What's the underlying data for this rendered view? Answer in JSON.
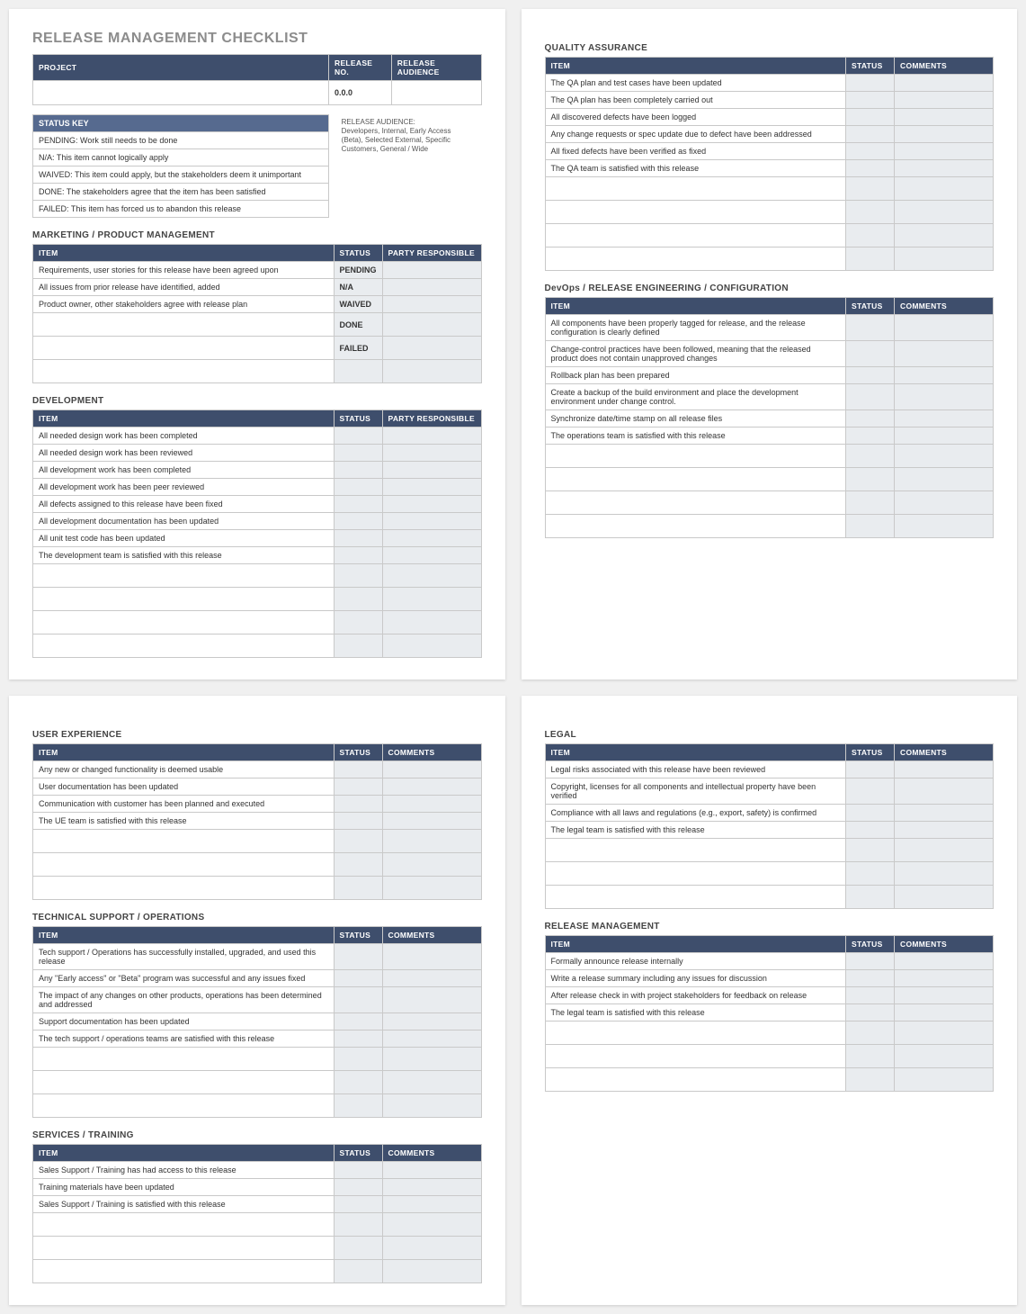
{
  "title": "RELEASE MANAGEMENT CHECKLIST",
  "project_table": {
    "headers": {
      "project": "PROJECT",
      "release_no": "RELEASE NO.",
      "release_audience": "RELEASE AUDIENCE"
    },
    "values": {
      "project": "",
      "release_no": "0.0.0",
      "release_audience": ""
    }
  },
  "release_audience_note": {
    "label": "RELEASE AUDIENCE:",
    "text": "Developers, Internal, Early Access (Beta), Selected External, Specific Customers, General / Wide"
  },
  "status_key": {
    "header": "STATUS KEY",
    "rows": [
      "PENDING:  Work still needs to be done",
      "N/A:  This item cannot logically apply",
      "WAIVED:  This item could apply, but the stakeholders deem it unimportant",
      "DONE:  The stakeholders agree that the item has been satisfied",
      "FAILED:  This item has forced us to abandon this release"
    ]
  },
  "headers": {
    "item": "ITEM",
    "status": "STATUS",
    "party": "PARTY RESPONSIBLE",
    "comments": "COMMENTS"
  },
  "sections": {
    "marketing": {
      "title": "MARKETING / PRODUCT MANAGEMENT",
      "third": "party",
      "rows": [
        {
          "item": "Requirements, user stories for this release have been agreed upon",
          "status": "PENDING"
        },
        {
          "item": "All issues from prior release have identified, added",
          "status": "N/A"
        },
        {
          "item": "Product owner, other stakeholders agree with release plan",
          "status": "WAIVED"
        },
        {
          "item": "",
          "status": "DONE"
        },
        {
          "item": "",
          "status": "FAILED"
        },
        {
          "item": "",
          "status": ""
        }
      ]
    },
    "development": {
      "title": "DEVELOPMENT",
      "third": "party",
      "rows": [
        {
          "item": "All needed design work has been completed",
          "status": ""
        },
        {
          "item": "All needed design work has been reviewed",
          "status": ""
        },
        {
          "item": "All development work has been completed",
          "status": ""
        },
        {
          "item": "All development work has been peer reviewed",
          "status": ""
        },
        {
          "item": "All defects assigned to this release have been fixed",
          "status": ""
        },
        {
          "item": "All development documentation has been updated",
          "status": ""
        },
        {
          "item": "All unit test code has been updated",
          "status": ""
        },
        {
          "item": "The development team is satisfied with this release",
          "status": ""
        },
        {
          "item": "",
          "status": ""
        },
        {
          "item": "",
          "status": ""
        },
        {
          "item": "",
          "status": ""
        },
        {
          "item": "",
          "status": ""
        }
      ]
    },
    "qa": {
      "title": "QUALITY ASSURANCE",
      "third": "comments",
      "rows": [
        {
          "item": "The QA plan and test cases have been updated",
          "status": ""
        },
        {
          "item": "The QA plan has been completely carried out",
          "status": ""
        },
        {
          "item": "All discovered defects have been logged",
          "status": ""
        },
        {
          "item": "Any change requests or spec update due to defect have been addressed",
          "status": ""
        },
        {
          "item": "All fixed defects have been verified as fixed",
          "status": ""
        },
        {
          "item": "The QA team is satisfied with this release",
          "status": ""
        },
        {
          "item": "",
          "status": ""
        },
        {
          "item": "",
          "status": ""
        },
        {
          "item": "",
          "status": ""
        },
        {
          "item": "",
          "status": ""
        }
      ]
    },
    "devops": {
      "title": "DevOps / RELEASE ENGINEERING / CONFIGURATION",
      "third": "comments",
      "rows": [
        {
          "item": "All components have been properly tagged for release, and the release configuration is clearly defined",
          "status": ""
        },
        {
          "item": "Change-control practices have been followed, meaning that the released product does not contain unapproved changes",
          "status": ""
        },
        {
          "item": "Rollback plan has been prepared",
          "status": ""
        },
        {
          "item": "Create a backup of the build environment and place the development environment under change control.",
          "status": ""
        },
        {
          "item": "Synchronize date/time stamp on all release files",
          "status": ""
        },
        {
          "item": "The operations team is satisfied with this release",
          "status": ""
        },
        {
          "item": "",
          "status": ""
        },
        {
          "item": "",
          "status": ""
        },
        {
          "item": "",
          "status": ""
        },
        {
          "item": "",
          "status": ""
        }
      ]
    },
    "ux": {
      "title": "USER EXPERIENCE",
      "third": "comments",
      "rows": [
        {
          "item": "Any new or changed functionality is deemed usable",
          "status": ""
        },
        {
          "item": "User documentation has been updated",
          "status": ""
        },
        {
          "item": "Communication with customer has been planned and executed",
          "status": ""
        },
        {
          "item": "The UE team is satisfied with this release",
          "status": ""
        },
        {
          "item": "",
          "status": ""
        },
        {
          "item": "",
          "status": ""
        },
        {
          "item": "",
          "status": ""
        }
      ]
    },
    "tech": {
      "title": "TECHNICAL SUPPORT / OPERATIONS",
      "third": "comments",
      "rows": [
        {
          "item": "Tech support / Operations has successfully installed, upgraded, and used this release",
          "status": ""
        },
        {
          "item": "Any \"Early access\" or \"Beta\" program was successful and any issues fixed",
          "status": ""
        },
        {
          "item": "The impact of any changes on other products, operations has been determined and addressed",
          "status": ""
        },
        {
          "item": "Support documentation has been updated",
          "status": ""
        },
        {
          "item": "The tech support / operations teams are satisfied with this release",
          "status": ""
        },
        {
          "item": "",
          "status": ""
        },
        {
          "item": "",
          "status": ""
        },
        {
          "item": "",
          "status": ""
        }
      ]
    },
    "services": {
      "title": "SERVICES / TRAINING",
      "third": "comments",
      "rows": [
        {
          "item": "Sales Support / Training has had access to this release",
          "status": ""
        },
        {
          "item": "Training materials have been updated",
          "status": ""
        },
        {
          "item": "Sales Support / Training is satisfied with this release",
          "status": ""
        },
        {
          "item": "",
          "status": ""
        },
        {
          "item": "",
          "status": ""
        },
        {
          "item": "",
          "status": ""
        }
      ]
    },
    "legal": {
      "title": "LEGAL",
      "third": "comments",
      "rows": [
        {
          "item": "Legal risks associated with this release have been reviewed",
          "status": ""
        },
        {
          "item": "Copyright, licenses for all components and intellectual property have been verified",
          "status": ""
        },
        {
          "item": "Compliance with all laws and regulations (e.g., export, safety) is confirmed",
          "status": ""
        },
        {
          "item": "The legal team is satisfied with this release",
          "status": ""
        },
        {
          "item": "",
          "status": ""
        },
        {
          "item": "",
          "status": ""
        },
        {
          "item": "",
          "status": ""
        }
      ]
    },
    "relmgmt": {
      "title": "RELEASE MANAGEMENT",
      "third": "comments",
      "rows": [
        {
          "item": "Formally announce release internally",
          "status": ""
        },
        {
          "item": "Write a release summary including any issues for discussion",
          "status": ""
        },
        {
          "item": "After release check in with project stakeholders for feedback on release",
          "status": ""
        },
        {
          "item": "The legal team is satisfied with this release",
          "status": ""
        },
        {
          "item": "",
          "status": ""
        },
        {
          "item": "",
          "status": ""
        },
        {
          "item": "",
          "status": ""
        }
      ]
    }
  }
}
